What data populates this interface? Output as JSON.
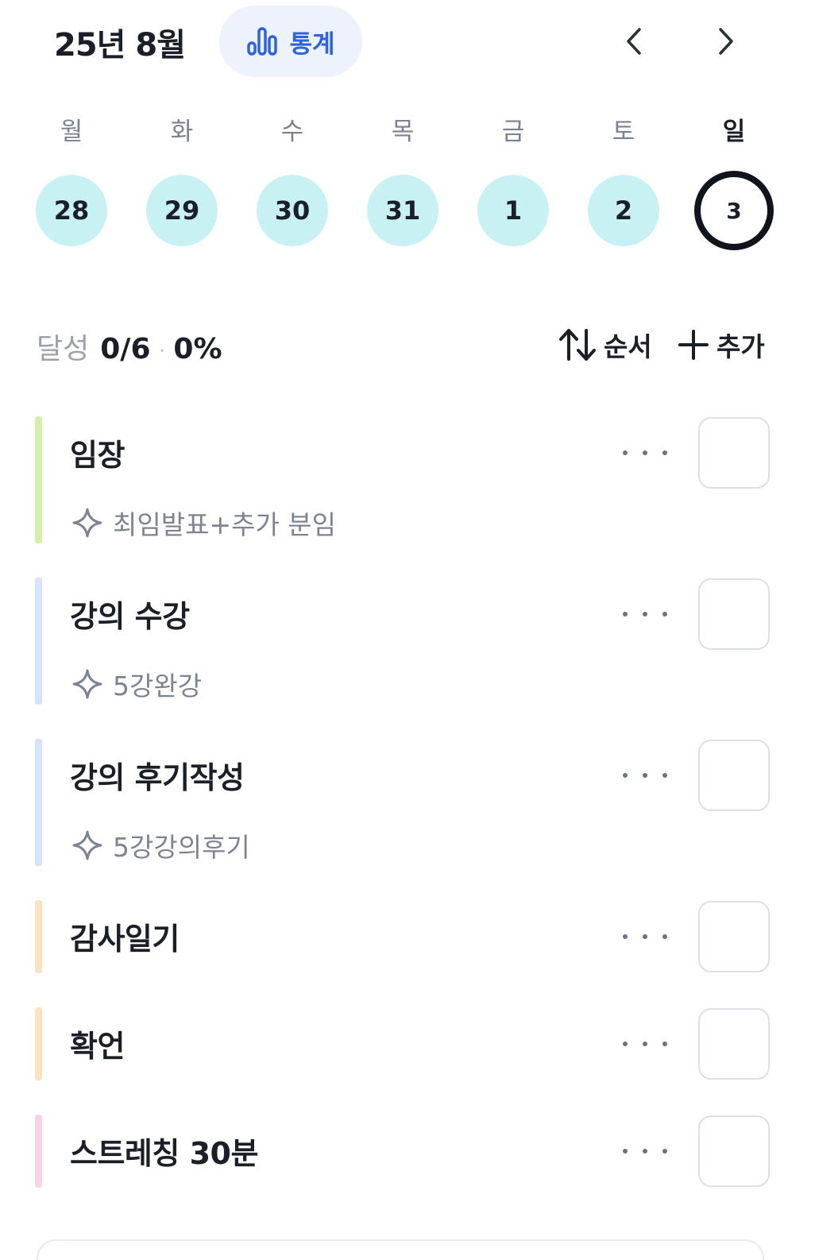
{
  "header": {
    "month_title": "25년 8월",
    "stats_label": "통계",
    "accent": "#2c63e0"
  },
  "week": {
    "weekdays": [
      "월",
      "화",
      "수",
      "목",
      "금",
      "토",
      "일"
    ],
    "days": [
      "28",
      "29",
      "30",
      "31",
      "1",
      "2",
      "3"
    ],
    "selected_day": "3",
    "day_color": "#c8f1f4"
  },
  "summary": {
    "label": "달성",
    "count": "0/6",
    "separator": "·",
    "percent": "0%"
  },
  "toolbar": {
    "sort_label": "순서",
    "add_label": "추가"
  },
  "habits": [
    {
      "title": "임장",
      "goal": "최임발표+추가 분임",
      "color": "#d6efa8"
    },
    {
      "title": "강의 수강",
      "goal": "5강완강",
      "color": "#d7e3fb"
    },
    {
      "title": "강의 후기작성",
      "goal": "5강강의후기",
      "color": "#d7e3fb"
    },
    {
      "title": "감사일기",
      "goal": "",
      "color": "#fde2c2"
    },
    {
      "title": "확언",
      "goal": "",
      "color": "#fde2c2"
    },
    {
      "title": "스트레칭 30분",
      "goal": "",
      "color": "#fbd3e6"
    }
  ]
}
